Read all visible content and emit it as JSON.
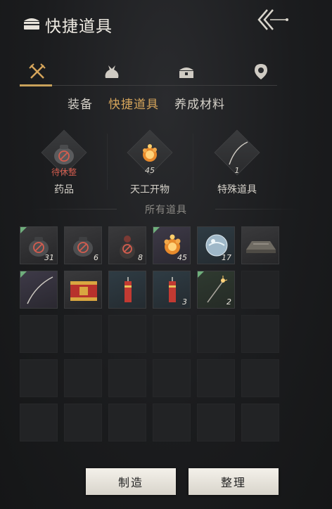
{
  "header": {
    "title": "快捷道具"
  },
  "category_tabs": [
    {
      "icon": "crossed-swords-icon",
      "active": true
    },
    {
      "icon": "pouch-icon",
      "active": false
    },
    {
      "icon": "chest-icon",
      "active": false
    },
    {
      "icon": "location-pin-icon",
      "active": false
    }
  ],
  "sub_tabs": [
    {
      "label": "装备",
      "active": false
    },
    {
      "label": "快捷道具",
      "active": true
    },
    {
      "label": "养成材料",
      "active": false
    }
  ],
  "quick_slots": [
    {
      "label": "药品",
      "status": "待休整",
      "icon": "medicine-jar-icon"
    },
    {
      "label": "天工开物",
      "count": "45",
      "icon": "fire-bomb-icon"
    },
    {
      "label": "特殊道具",
      "count": "1",
      "icon": "hook-blade-icon"
    }
  ],
  "section": {
    "title": "所有道具"
  },
  "items": [
    {
      "icon": "medicine-jar-icon",
      "count": "31",
      "corner": true,
      "tint": "normal"
    },
    {
      "icon": "medicine-jar-icon",
      "count": "6",
      "corner": false,
      "tint": "normal"
    },
    {
      "icon": "medicine-gourd-icon",
      "count": "8",
      "corner": false,
      "tint": "normal"
    },
    {
      "icon": "fire-bomb-icon",
      "count": "45",
      "corner": true,
      "tint": "purple"
    },
    {
      "icon": "water-orb-icon",
      "count": "17",
      "corner": false,
      "tint": "blue"
    },
    {
      "icon": "trap-platform-icon",
      "count": "",
      "corner": false,
      "tint": "normal"
    },
    {
      "icon": "hook-blade-icon",
      "count": "",
      "corner": true,
      "tint": "purple"
    },
    {
      "icon": "firework-box-icon",
      "count": "",
      "corner": false,
      "tint": "normal"
    },
    {
      "icon": "firecracker-icon",
      "count": "",
      "corner": false,
      "tint": "blue"
    },
    {
      "icon": "firecracker-icon",
      "count": "3",
      "corner": false,
      "tint": "blue"
    },
    {
      "icon": "sparkler-icon",
      "count": "2",
      "corner": true,
      "tint": "green"
    }
  ],
  "buttons": {
    "craft": "制造",
    "sort": "整理"
  },
  "colors": {
    "accent": "#d6a55b",
    "rest_status": "#d45d4f",
    "button_bg": "#efebe3"
  }
}
